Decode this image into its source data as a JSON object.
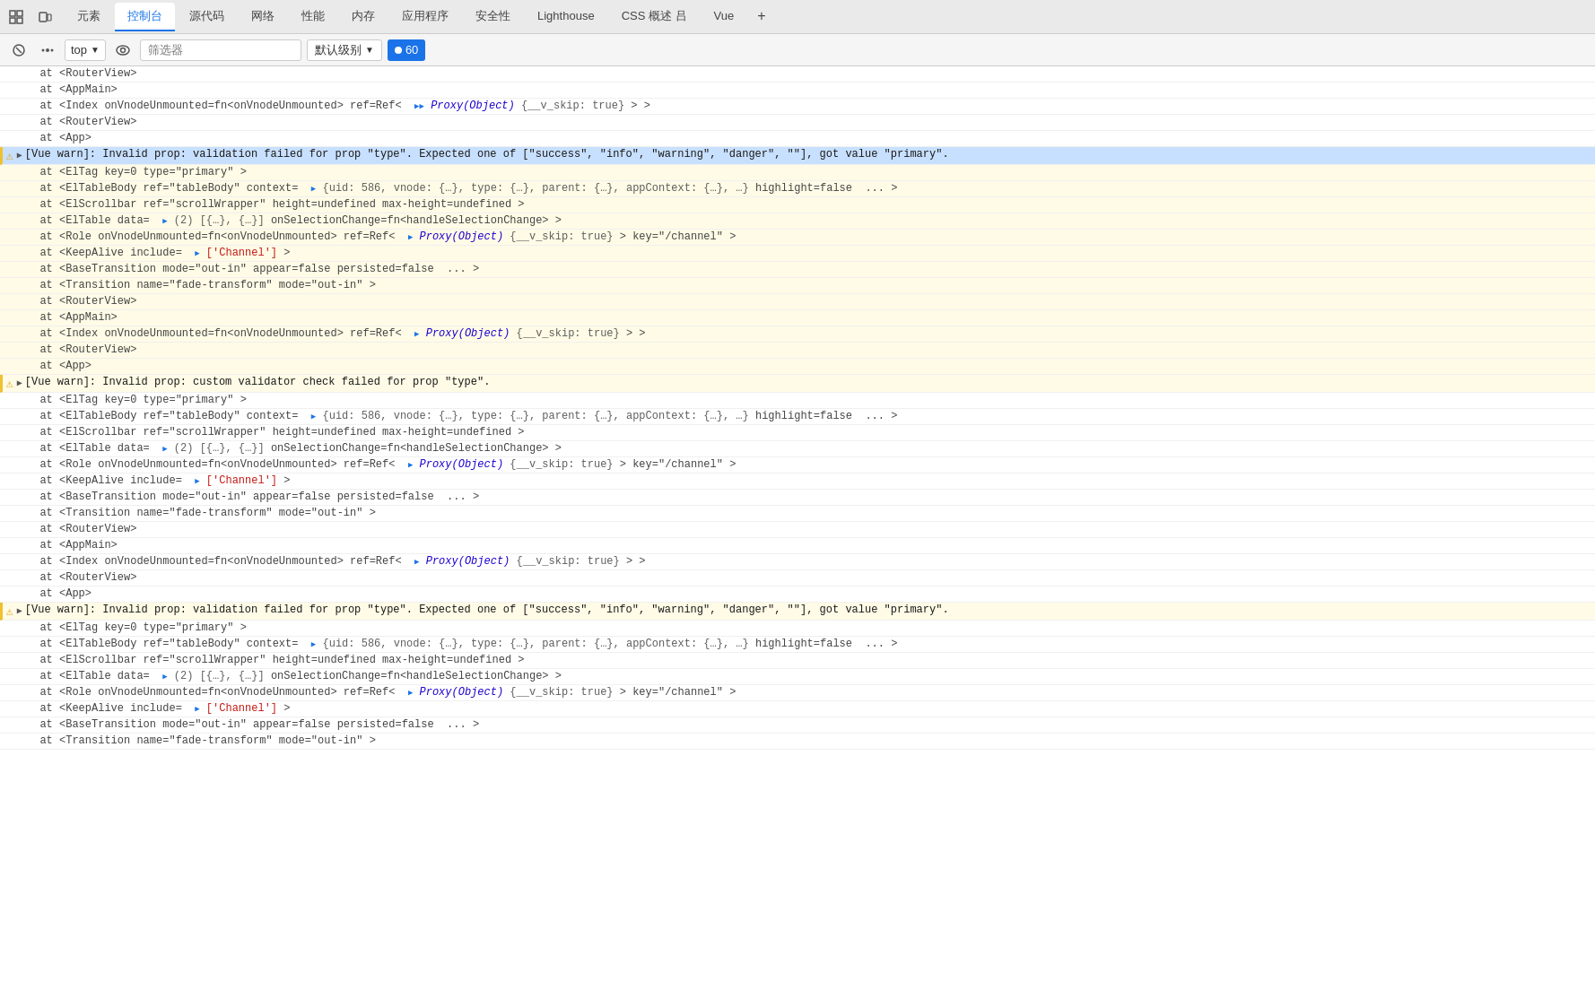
{
  "tabBar": {
    "icons": [
      {
        "name": "inspect-icon",
        "symbol": "⬚"
      },
      {
        "name": "device-icon",
        "symbol": "⧉"
      }
    ],
    "tabs": [
      {
        "label": "元素",
        "id": "elements"
      },
      {
        "label": "控制台",
        "id": "console",
        "active": true
      },
      {
        "label": "源代码",
        "id": "sources"
      },
      {
        "label": "网络",
        "id": "network"
      },
      {
        "label": "性能",
        "id": "performance"
      },
      {
        "label": "内存",
        "id": "memory"
      },
      {
        "label": "应用程序",
        "id": "application"
      },
      {
        "label": "安全性",
        "id": "security"
      },
      {
        "label": "Lighthouse",
        "id": "lighthouse"
      },
      {
        "label": "CSS 概述 吕",
        "id": "css-overview"
      },
      {
        "label": "Vue",
        "id": "vue"
      },
      {
        "label": "+",
        "id": "more"
      }
    ]
  },
  "toolbar": {
    "clearIcon": "🚫",
    "topLabel": "top",
    "filterPlaceholder": "筛选器",
    "levelLabel": "默认级别",
    "messageCount": "60"
  },
  "consoleLines": [
    {
      "type": "stack",
      "indent": 0,
      "text": "at <RouterView>"
    },
    {
      "type": "stack",
      "indent": 0,
      "text": "at <AppMain>"
    },
    {
      "type": "stack",
      "indent": 0,
      "text": "at <Index onVnodeUnmounted=fn<onVnodeUnmounted> ref=Ref<  "
    },
    {
      "type": "stack",
      "indent": 0,
      "text": "at <RouterView>"
    },
    {
      "type": "stack",
      "indent": 0,
      "text": "at <App>"
    },
    {
      "type": "warning",
      "selected": true,
      "text": "[Vue warn]: Invalid prop: validation failed for prop \"type\". Expected one of [\"success\", \"info\", \"warning\", \"danger\", \"\"], got value \"primary\"."
    },
    {
      "type": "stack",
      "warn": true,
      "text": "at <ElTag key=0 type=\"primary\" >"
    },
    {
      "type": "stack",
      "warn": true,
      "text": "at <ElTableBody ref=\"tableBody\" context=  ► {uid: 586, vnode: {…}, type: {…}, parent: {…}, appContext: {…}, …} highlight=false  ... >"
    },
    {
      "type": "stack",
      "warn": true,
      "text": "at <ElScrollbar ref=\"scrollWrapper\" height=undefined max-height=undefined >"
    },
    {
      "type": "stack",
      "warn": true,
      "text": "at <ElTable data=  ► (2) [{…}, {…}] onSelectionChange=fn<handleSelectionChange> >"
    },
    {
      "type": "stack",
      "warn": true,
      "text": "at <Role onVnodeUnmounted=fn<onVnodeUnmounted> ref=Ref<  ► Proxy(Object) {__v_skip: true} > key=\"/channel\" >"
    },
    {
      "type": "stack",
      "warn": true,
      "text": "at <KeepAlive include=  ► ['Channel'] >"
    },
    {
      "type": "stack",
      "warn": true,
      "text": "at <BaseTransition mode=\"out-in\" appear=false persisted=false  ... >"
    },
    {
      "type": "stack",
      "warn": true,
      "text": "at <Transition name=\"fade-transform\" mode=\"out-in\" >"
    },
    {
      "type": "stack",
      "warn": true,
      "text": "at <RouterView>"
    },
    {
      "type": "stack",
      "warn": true,
      "text": "at <AppMain>"
    },
    {
      "type": "stack",
      "warn": true,
      "text": "at <Index onVnodeUnmounted=fn<onVnodeUnmounted> ref=Ref<  ► Proxy(Object) {__v_skip: true} > >"
    },
    {
      "type": "stack",
      "warn": true,
      "text": "at <RouterView>"
    },
    {
      "type": "stack",
      "warn": true,
      "text": "at <App>"
    },
    {
      "type": "warning",
      "selected": false,
      "text": "[Vue warn]: Invalid prop: custom validator check failed for prop \"type\"."
    },
    {
      "type": "stack",
      "warn": false,
      "text": "at <ElTag key=0 type=\"primary\" >"
    },
    {
      "type": "stack",
      "warn": false,
      "text": "at <ElTableBody ref=\"tableBody\" context=  ► {uid: 586, vnode: {…}, type: {…}, parent: {…}, appContext: {…}, …} highlight=false  ... >"
    },
    {
      "type": "stack",
      "warn": false,
      "text": "at <ElScrollbar ref=\"scrollWrapper\" height=undefined max-height=undefined >"
    },
    {
      "type": "stack",
      "warn": false,
      "text": "at <ElTable data=  ► (2) [{…}, {…}] onSelectionChange=fn<handleSelectionChange> >"
    },
    {
      "type": "stack",
      "warn": false,
      "text": "at <Role onVnodeUnmounted=fn<onVnodeUnmounted> ref=Ref<  ► Proxy(Object) {__v_skip: true} > key=\"/channel\" >"
    },
    {
      "type": "stack",
      "warn": false,
      "text": "at <KeepAlive include=  ► ['Channel'] >"
    },
    {
      "type": "stack",
      "warn": false,
      "text": "at <BaseTransition mode=\"out-in\" appear=false persisted=false  ... >"
    },
    {
      "type": "stack",
      "warn": false,
      "text": "at <Transition name=\"fade-transform\" mode=\"out-in\" >"
    },
    {
      "type": "stack",
      "warn": false,
      "text": "at <RouterView>"
    },
    {
      "type": "stack",
      "warn": false,
      "text": "at <AppMain>"
    },
    {
      "type": "stack",
      "warn": false,
      "text": "at <Index onVnodeUnmounted=fn<onVnodeUnmounted> ref=Ref<  ► Proxy(Object) {__v_skip: true} > >"
    },
    {
      "type": "stack",
      "warn": false,
      "text": "at <RouterView>"
    },
    {
      "type": "stack",
      "warn": false,
      "text": "at <App>"
    },
    {
      "type": "warning",
      "selected": false,
      "text": "[Vue warn]: Invalid prop: validation failed for prop \"type\". Expected one of [\"success\", \"info\", \"warning\", \"danger\", \"\"], got value \"primary\"."
    },
    {
      "type": "stack",
      "warn": false,
      "text": "at <ElTag key=0 type=\"primary\" >"
    },
    {
      "type": "stack",
      "warn": false,
      "text": "at <ElTableBody ref=\"tableBody\" context=  ► {uid: 586, vnode: {…}, type: {…}, parent: {…}, appContext: {…}, …} highlight=false  ... >"
    },
    {
      "type": "stack",
      "warn": false,
      "text": "at <ElScrollbar ref=\"scrollWrapper\" height=undefined max-height=undefined >"
    },
    {
      "type": "stack",
      "warn": false,
      "text": "at <ElTable data=  ► (2) [{…}, {…}] onSelectionChange=fn<handleSelectionChange> >"
    },
    {
      "type": "stack",
      "warn": false,
      "text": "at <Role onVnodeUnmounted=fn<onVnodeUnmounted> ref=Ref<  ► Proxy(Object) {__v_skip: true} > key=\"/channel\" >"
    },
    {
      "type": "stack",
      "warn": false,
      "text": "at <KeepAlive include=  ► ['Channel'] >"
    },
    {
      "type": "stack",
      "warn": false,
      "text": "at <BaseTransition mode=\"out-in\" appear=false persisted=false  ... >"
    },
    {
      "type": "stack",
      "warn": false,
      "text": "at <Transition name=\"fade-transform\" mode=\"out-in\" >"
    }
  ]
}
